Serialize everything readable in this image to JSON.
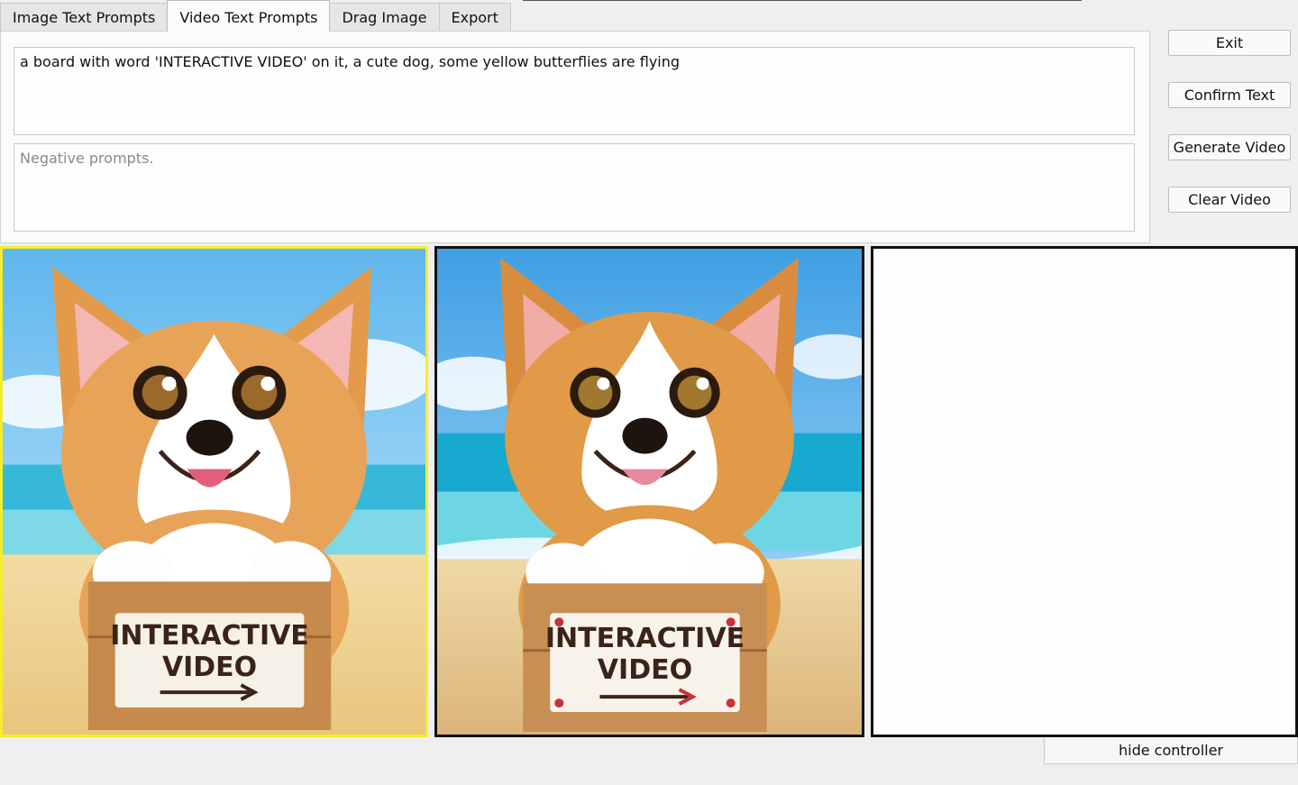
{
  "tabs": [
    {
      "label": "Image Text Prompts",
      "active": false
    },
    {
      "label": "Video Text Prompts",
      "active": true
    },
    {
      "label": "Drag Image",
      "active": false
    },
    {
      "label": "Export",
      "active": false
    }
  ],
  "prompt": {
    "value": "a board with word 'INTERACTIVE VIDEO' on it, a cute dog, some yellow butterflies are flying",
    "negative_placeholder": "Negative prompts."
  },
  "buttons": {
    "exit": "Exit",
    "confirm_text": "Confirm Text",
    "generate_video": "Generate Video",
    "clear_video": "Clear Video",
    "hide_controller": "hide controller"
  },
  "sign": {
    "line1": "INTERACTIVE",
    "line2": "VIDEO"
  },
  "colors": {
    "selected_frame": "#f4ee2a",
    "frame_border": "#111111"
  }
}
